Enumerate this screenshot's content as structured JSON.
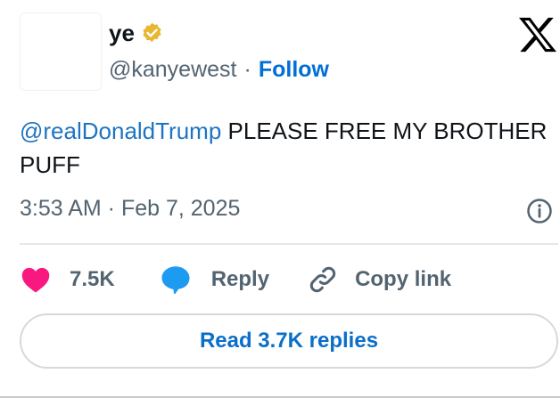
{
  "author": {
    "name": "ye",
    "handle": "@kanyewest",
    "separator": "·",
    "follow_label": "Follow",
    "verified_badge_color": "#e8b631"
  },
  "logo": {
    "icon": "x-logo-icon",
    "color": "#000000"
  },
  "tweet": {
    "mention": "@realDonaldTrump",
    "text": " PLEASE FREE MY BROTHER PUFF",
    "time": "3:53 AM",
    "separator": " · ",
    "date": "Feb 7, 2025"
  },
  "actions": {
    "likes": "7.5K",
    "reply_label": "Reply",
    "copy_label": "Copy link",
    "like_color": "#f91880",
    "reply_icon_color": "#1d9bf0"
  },
  "read_replies_label": "Read 3.7K replies",
  "colors": {
    "link": "#1d74c2",
    "muted": "#536471",
    "text": "#0f1419"
  }
}
